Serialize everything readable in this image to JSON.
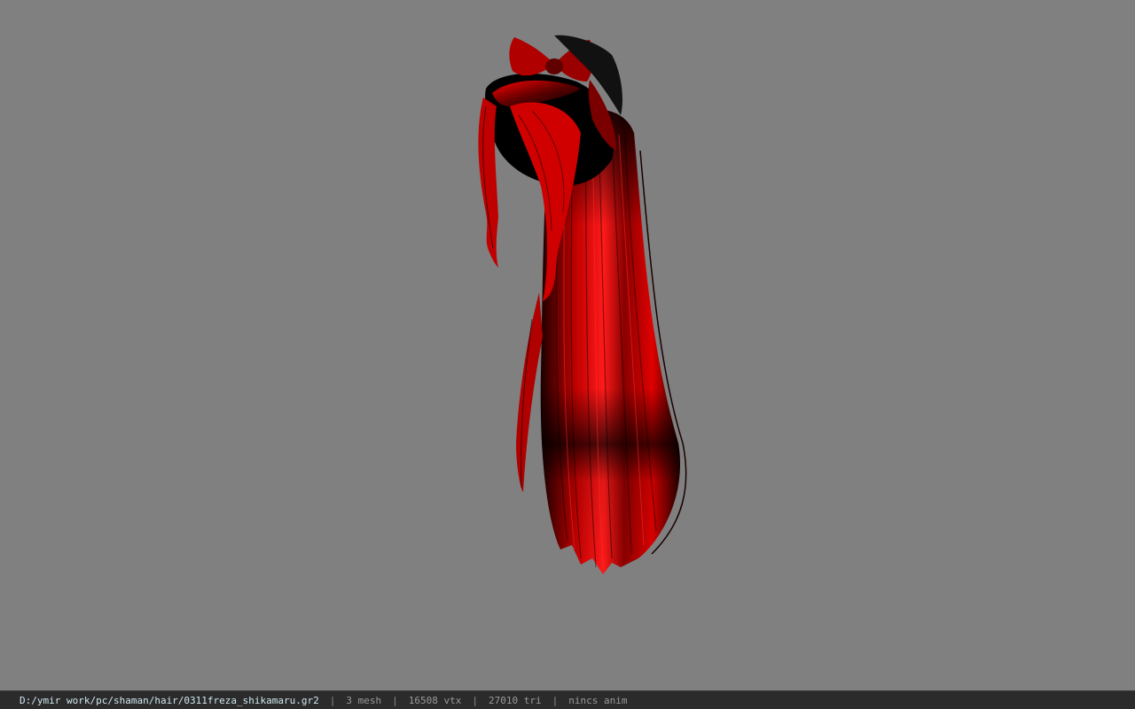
{
  "viewport": {
    "background": "#808080",
    "model_description_name": "hair-mesh",
    "hair_color": "#d40000",
    "shadow_color": "#000000"
  },
  "status": {
    "file_path": "D:/ymir work/pc/shaman/hair/0311freza_shikamaru.gr2",
    "separator": "|",
    "mesh": "3 mesh",
    "vtx": "16508 vtx",
    "tri": "27010 tri",
    "anim": "nincs anim"
  }
}
